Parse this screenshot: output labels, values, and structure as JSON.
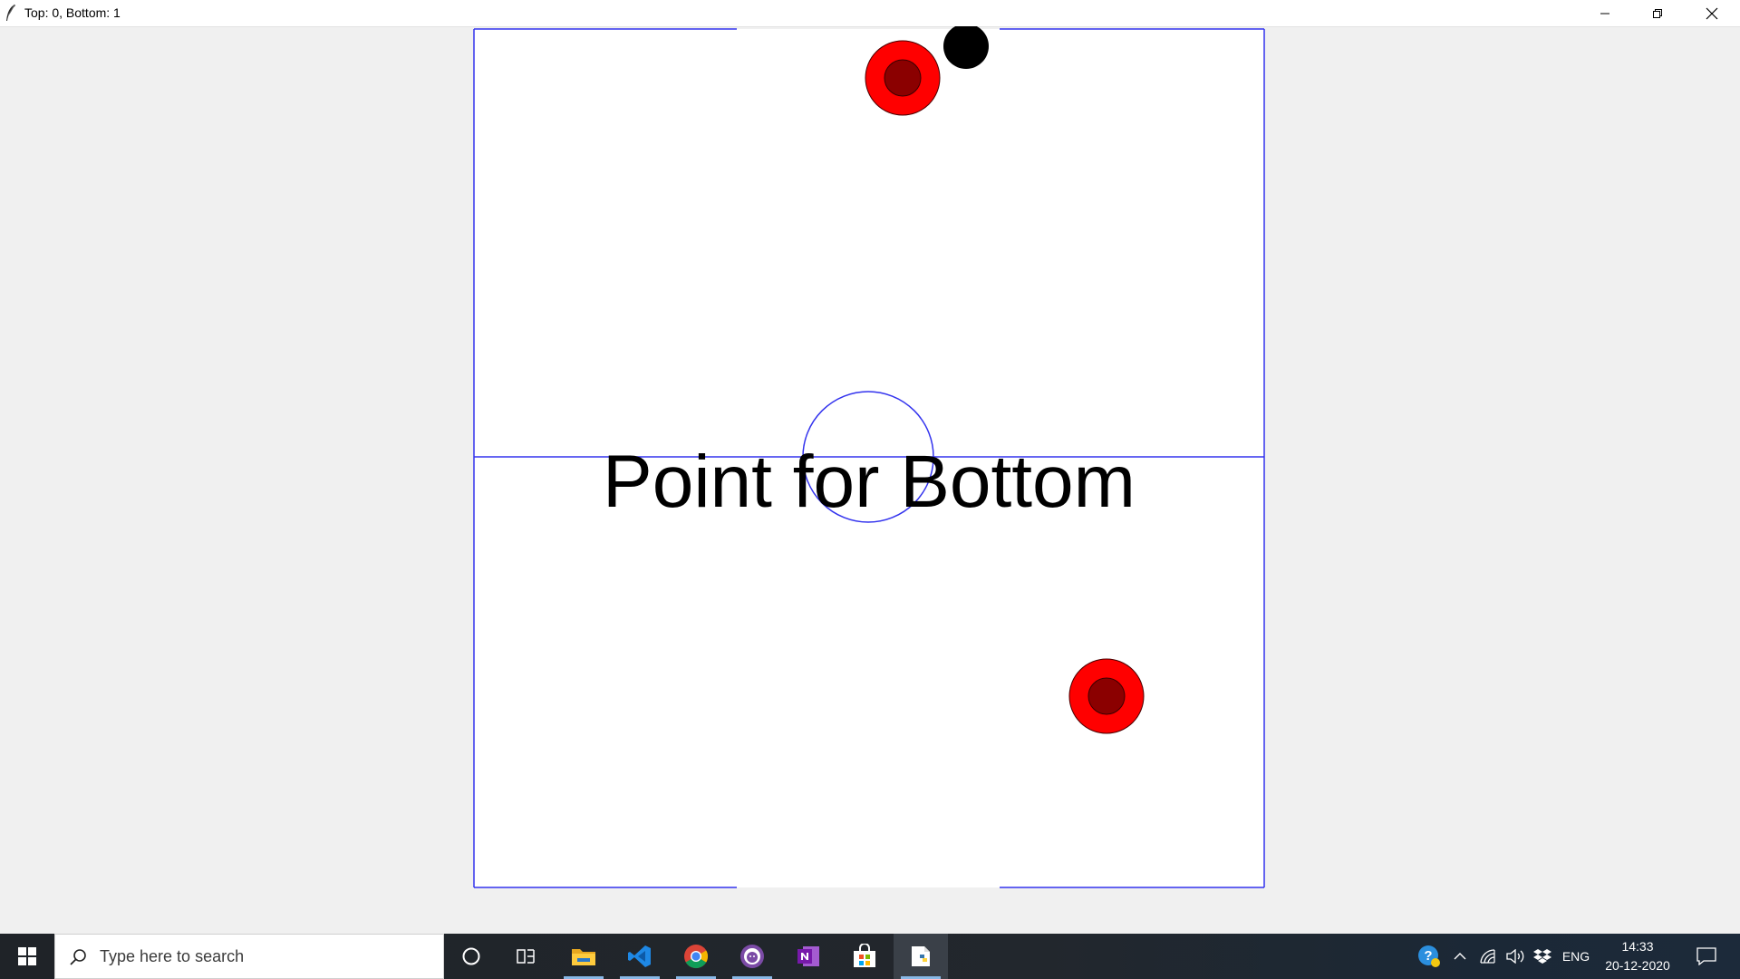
{
  "window": {
    "title": "Top: 0, Bottom: 1",
    "icon": "feather-icon",
    "controls": [
      "minimize-icon",
      "restore-icon",
      "close-icon"
    ]
  },
  "game": {
    "message": "Point for Bottom",
    "score": {
      "top": 0,
      "bottom": 1
    },
    "colors": {
      "field_lines": "#3333ee",
      "paddle_outer": "#ff0000",
      "paddle_inner": "#8b0000",
      "puck": "#000000",
      "field": "#ffffff"
    }
  },
  "taskbar": {
    "start_icon": "windows-start-icon",
    "search_placeholder": "Type here to search",
    "apps": [
      {
        "name": "cortana-icon"
      },
      {
        "name": "task-view-icon"
      },
      {
        "name": "file-explorer-icon"
      },
      {
        "name": "vscode-icon"
      },
      {
        "name": "chrome-icon"
      },
      {
        "name": "github-desktop-icon"
      },
      {
        "name": "onenote-icon"
      },
      {
        "name": "store-icon"
      },
      {
        "name": "python-app-icon",
        "active": true
      }
    ],
    "tray": {
      "icons": [
        "help-icon",
        "show-hidden-icons-chevron",
        "network-icon",
        "volume-icon",
        "dropbox-icon"
      ],
      "language": "ENG",
      "time": "14:33",
      "date": "20-12-2020",
      "notification_icon": "notification-icon"
    }
  }
}
